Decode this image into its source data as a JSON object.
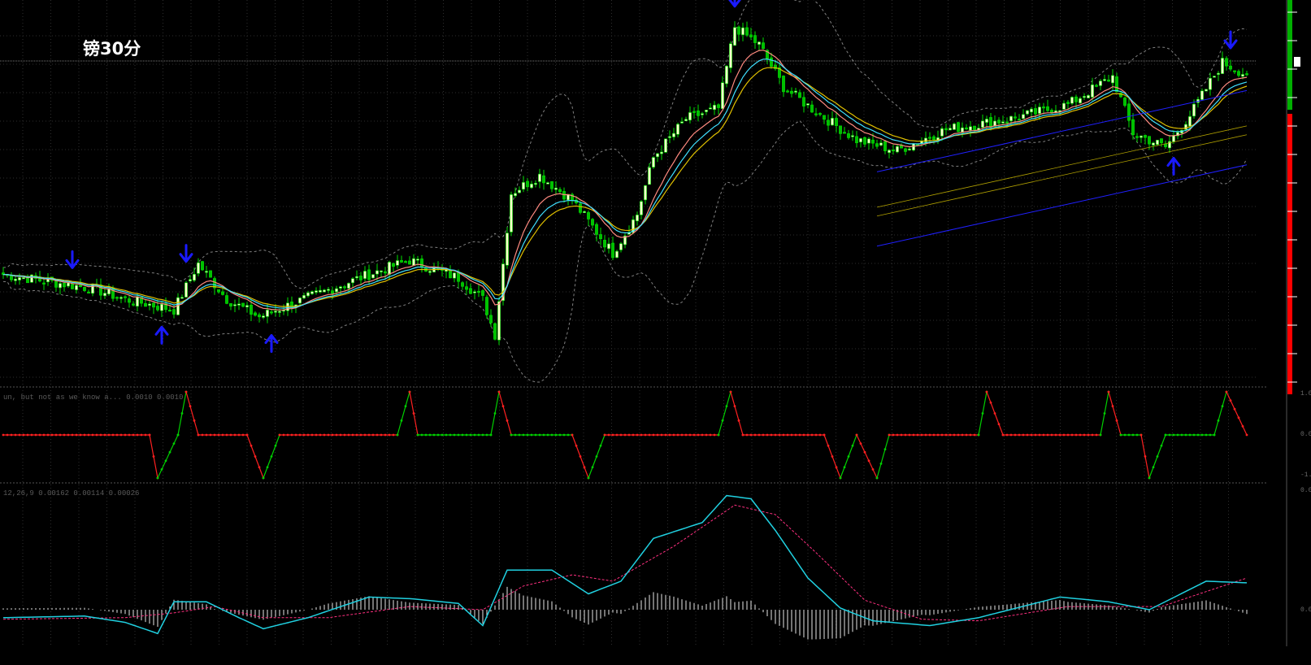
{
  "title": "镑30分",
  "panes": {
    "oscillator_label": "un, but not as we know a...  0.0010 0.0010",
    "macd_label": "12,26,9  0.00162  0.00114  0.00026",
    "axis_top": "1.0",
    "axis_mid": "0.0",
    "axis_bottom": "-1.0",
    "macd_axis_top": "0.0",
    "macd_axis_zero": "0.0"
  },
  "colors": {
    "background": "#000000",
    "grid": "#2e2e2e",
    "bull_candle": "#ffffcc",
    "bear_candle": "#00c000",
    "wick": "#00e000",
    "ma_fast": "#ff8a80",
    "ma_slow": "#40e0ff",
    "ma_mid": "#e0c000",
    "bollinger": "#808080",
    "arrow": "#1a1aff",
    "channel_outer": "#2020ff",
    "channel_inner": "#b0a000",
    "osc_up": "#00d000",
    "osc_down": "#ff2020",
    "macd_line": "#20d0e0",
    "signal_line": "#ff3080",
    "histogram": "#e8e8e8",
    "side_bar_green": "#00b000",
    "side_bar_red": "#ff0000"
  },
  "chart_data": [
    {
      "type": "candlestick",
      "title": "镑30分",
      "indicators": [
        "moving averages",
        "bollinger bands",
        "regression channel",
        "fractal arrows"
      ],
      "price_norm_range": [
        0,
        1
      ],
      "keypoints": [
        [
          0,
          0.27
        ],
        [
          22,
          0.23
        ],
        [
          30,
          0.2
        ],
        [
          42,
          0.17
        ],
        [
          48,
          0.3
        ],
        [
          55,
          0.2
        ],
        [
          63,
          0.15
        ],
        [
          74,
          0.2
        ],
        [
          90,
          0.27
        ],
        [
          100,
          0.31
        ],
        [
          112,
          0.26
        ],
        [
          118,
          0.2
        ],
        [
          121,
          0.1
        ],
        [
          125,
          0.5
        ],
        [
          132,
          0.55
        ],
        [
          140,
          0.48
        ],
        [
          150,
          0.33
        ],
        [
          156,
          0.44
        ],
        [
          160,
          0.6
        ],
        [
          168,
          0.71
        ],
        [
          176,
          0.74
        ],
        [
          180,
          0.97
        ],
        [
          186,
          0.92
        ],
        [
          192,
          0.8
        ],
        [
          200,
          0.73
        ],
        [
          210,
          0.65
        ],
        [
          220,
          0.62
        ],
        [
          232,
          0.68
        ],
        [
          248,
          0.71
        ],
        [
          262,
          0.75
        ],
        [
          273,
          0.83
        ],
        [
          278,
          0.67
        ],
        [
          286,
          0.63
        ],
        [
          292,
          0.72
        ],
        [
          300,
          0.87
        ],
        [
          305,
          0.84
        ]
      ],
      "down_arrow_bars": [
        17,
        45,
        180,
        302
      ],
      "up_arrow_bars": [
        39,
        66,
        288
      ]
    },
    {
      "type": "line",
      "name": "oscillator",
      "levels": {
        "top": 1,
        "mid": 0,
        "bottom": -1
      },
      "segments": [
        [
          0,
          0
        ],
        [
          36,
          0
        ],
        [
          38,
          -1
        ],
        [
          43,
          0
        ],
        [
          45,
          1
        ],
        [
          48,
          0
        ],
        [
          60,
          0
        ],
        [
          64,
          -1
        ],
        [
          68,
          0
        ],
        [
          97,
          0
        ],
        [
          100,
          1
        ],
        [
          102,
          0
        ],
        [
          120,
          0
        ],
        [
          122,
          1
        ],
        [
          125,
          0
        ],
        [
          140,
          0
        ],
        [
          144,
          -1
        ],
        [
          148,
          0
        ],
        [
          176,
          0
        ],
        [
          179,
          1
        ],
        [
          182,
          0
        ],
        [
          202,
          0
        ],
        [
          206,
          -1
        ],
        [
          210,
          0
        ],
        [
          215,
          -1
        ],
        [
          218,
          0
        ],
        [
          240,
          0
        ],
        [
          242,
          1
        ],
        [
          246,
          0
        ],
        [
          270,
          0
        ],
        [
          272,
          1
        ],
        [
          275,
          0
        ],
        [
          280,
          0
        ],
        [
          282,
          -1
        ],
        [
          286,
          0
        ],
        [
          298,
          0
        ],
        [
          301,
          1
        ],
        [
          306,
          0
        ]
      ]
    },
    {
      "type": "line",
      "name": "MACD",
      "parameters": "12,26,9",
      "macd_keypoints": [
        [
          0,
          -0.05
        ],
        [
          20,
          -0.04
        ],
        [
          30,
          -0.08
        ],
        [
          38,
          -0.15
        ],
        [
          42,
          0.05
        ],
        [
          50,
          0.05
        ],
        [
          58,
          -0.05
        ],
        [
          64,
          -0.12
        ],
        [
          75,
          -0.05
        ],
        [
          90,
          0.08
        ],
        [
          100,
          0.07
        ],
        [
          112,
          0.04
        ],
        [
          118,
          -0.1
        ],
        [
          124,
          0.25
        ],
        [
          135,
          0.25
        ],
        [
          144,
          0.1
        ],
        [
          152,
          0.18
        ],
        [
          160,
          0.45
        ],
        [
          172,
          0.55
        ],
        [
          178,
          0.72
        ],
        [
          184,
          0.7
        ],
        [
          190,
          0.5
        ],
        [
          198,
          0.2
        ],
        [
          206,
          0.01
        ],
        [
          214,
          -0.07
        ],
        [
          228,
          -0.1
        ],
        [
          240,
          -0.05
        ],
        [
          260,
          0.08
        ],
        [
          272,
          0.05
        ],
        [
          282,
          0.0
        ],
        [
          296,
          0.18
        ],
        [
          306,
          0.17
        ]
      ],
      "signal_keypoints": [
        [
          0,
          -0.06
        ],
        [
          30,
          -0.05
        ],
        [
          42,
          -0.02
        ],
        [
          52,
          0.02
        ],
        [
          64,
          -0.05
        ],
        [
          80,
          -0.05
        ],
        [
          100,
          0.02
        ],
        [
          118,
          0.0
        ],
        [
          128,
          0.15
        ],
        [
          140,
          0.22
        ],
        [
          150,
          0.18
        ],
        [
          165,
          0.4
        ],
        [
          180,
          0.66
        ],
        [
          190,
          0.6
        ],
        [
          200,
          0.36
        ],
        [
          212,
          0.06
        ],
        [
          226,
          -0.06
        ],
        [
          240,
          -0.07
        ],
        [
          262,
          0.02
        ],
        [
          285,
          0.02
        ],
        [
          306,
          0.2
        ]
      ]
    }
  ]
}
